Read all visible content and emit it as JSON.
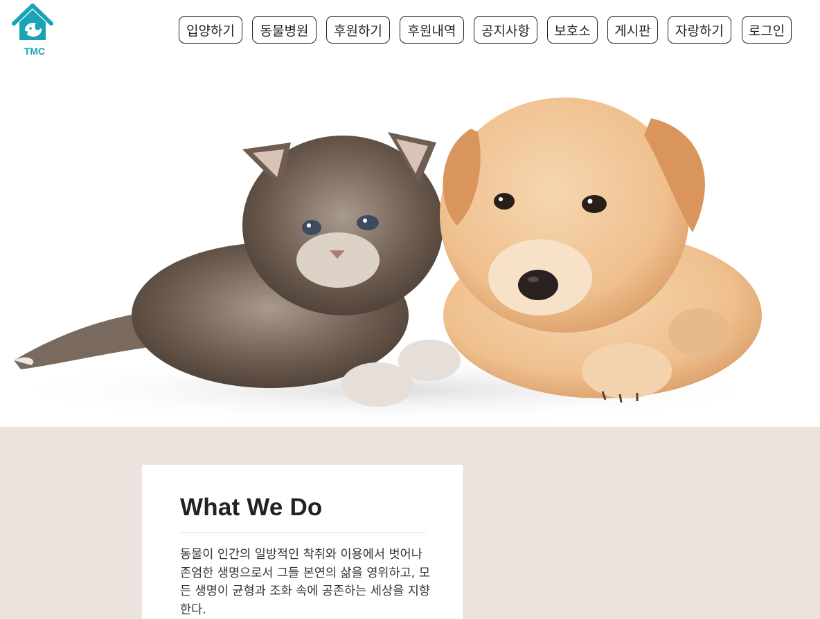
{
  "brand": {
    "logo_text": "TMC",
    "accent": "#1aa3b5"
  },
  "nav": {
    "items": [
      {
        "label": "입양하기"
      },
      {
        "label": "동물병원"
      },
      {
        "label": "후원하기"
      },
      {
        "label": "후원내역"
      },
      {
        "label": "공지사항"
      },
      {
        "label": "보호소"
      },
      {
        "label": "게시판"
      },
      {
        "label": "자랑하기"
      },
      {
        "label": "로그인"
      }
    ]
  },
  "about": {
    "title": "What We Do",
    "body": "동물이 인간의 일방적인 착취와 이용에서 벗어나 존엄한 생명으로서 그들 본연의 삶을 영위하고, 모든 생명이 균형과 조화 속에 공존하는 세상을 지향한다."
  },
  "colors": {
    "section_bg": "#ede3df",
    "card_bg": "#ffffff"
  }
}
